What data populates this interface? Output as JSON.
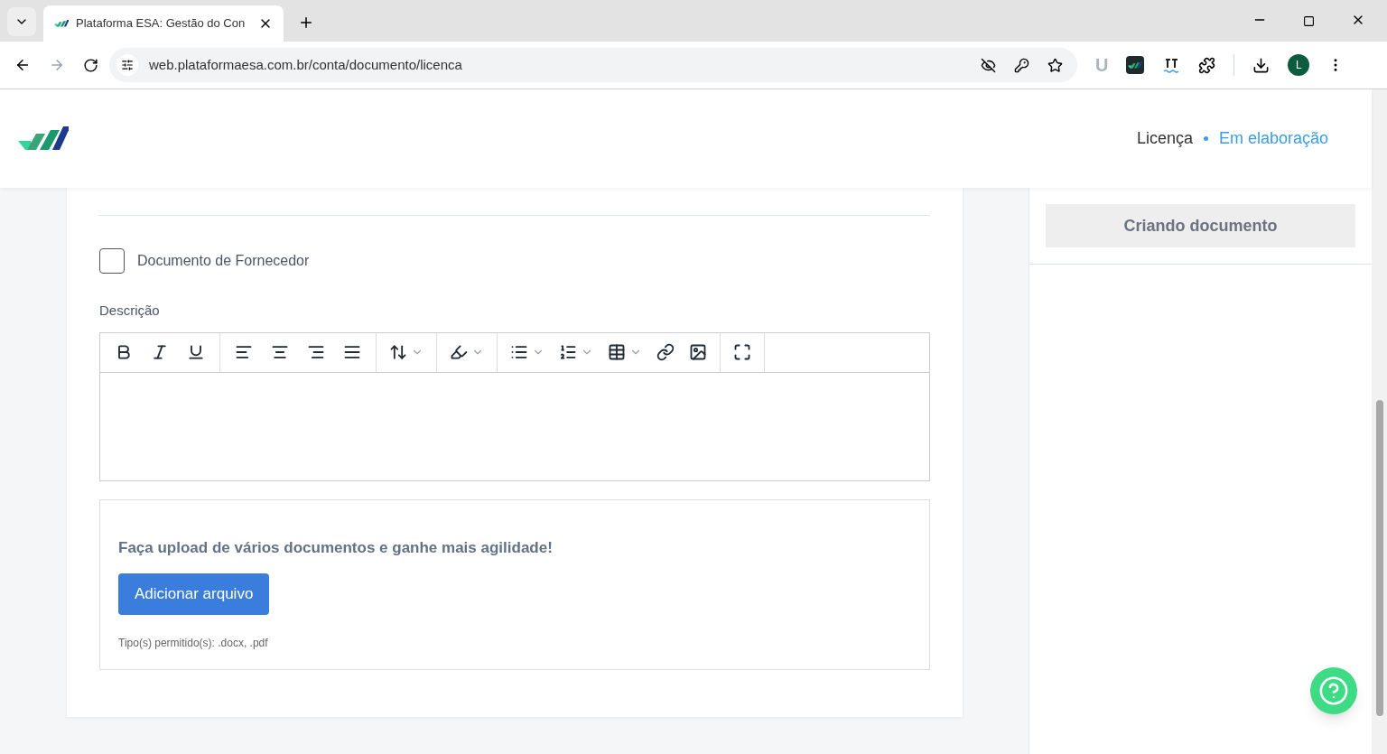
{
  "browser": {
    "tab_title": "Plataforma ESA: Gestão do Con",
    "url": "web.plataformaesa.com.br/conta/documento/licenca",
    "profile_initial": "L",
    "extension_letter": "U"
  },
  "header": {
    "document_type": "Licença",
    "status": "Em elaboração"
  },
  "form": {
    "supplier_checkbox": {
      "label": "Documento de Fornecedor",
      "checked": false
    },
    "description": {
      "label": "Descrição"
    },
    "upload": {
      "heading": "Faça upload de vários documentos e ganhe mais agilidade!",
      "button": "Adicionar arquivo",
      "allowed_types": "Tipo(s) permitido(s): .docx, .pdf"
    }
  },
  "sidebar": {
    "status_button": "Criando documento"
  }
}
